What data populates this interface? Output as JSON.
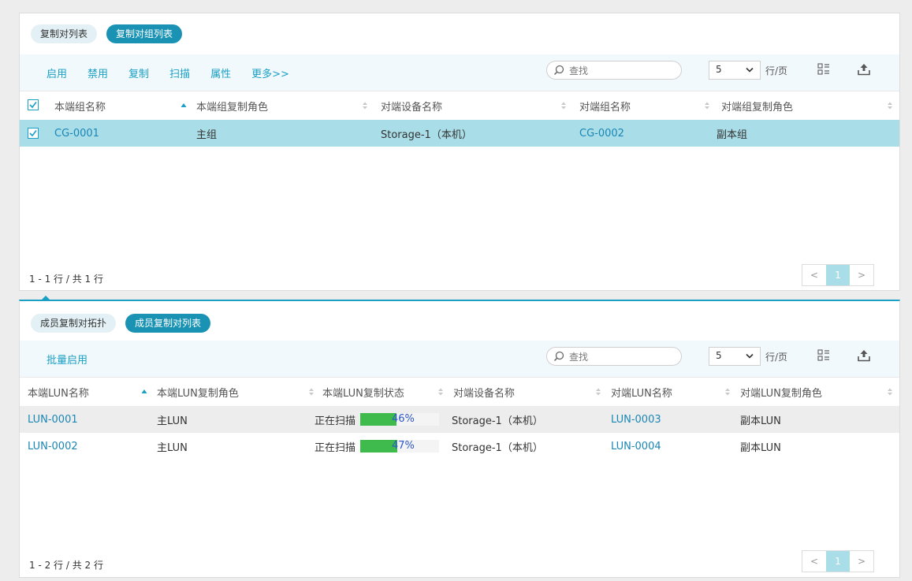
{
  "top": {
    "tabs": [
      {
        "label": "复制对列表",
        "active": false
      },
      {
        "label": "复制对组列表",
        "active": true
      }
    ],
    "actions": [
      "启用",
      "禁用",
      "复制",
      "扫描",
      "属性",
      "更多>>"
    ],
    "search": {
      "placeholder": "查找",
      "value": ""
    },
    "page_size": "5",
    "per_page_label": "行/页",
    "columns": [
      "本端组名称",
      "本端组复制角色",
      "对端设备名称",
      "对端组名称",
      "对端组复制角色"
    ],
    "rows": [
      {
        "checked": true,
        "local_group": "CG-0001",
        "local_role": "主组",
        "peer_device": "Storage-1（本机）",
        "peer_group": "CG-0002",
        "peer_role": "副本组"
      }
    ],
    "header_checked": true,
    "footer": "1 - 1 行 / 共 1 行",
    "pager": {
      "prev": "<",
      "current": "1",
      "next": ">"
    }
  },
  "bottom": {
    "tabs": [
      {
        "label": "成员复制对拓扑",
        "active": false
      },
      {
        "label": "成员复制对列表",
        "active": true
      }
    ],
    "actions": [
      "批量启用"
    ],
    "search": {
      "placeholder": "查找",
      "value": ""
    },
    "page_size": "5",
    "per_page_label": "行/页",
    "columns": [
      "本端LUN名称",
      "本端LUN复制角色",
      "本端LUN复制状态",
      "对端设备名称",
      "对端LUN名称",
      "对端LUN复制角色"
    ],
    "rows": [
      {
        "local_lun": "LUN-0001",
        "local_role": "主LUN",
        "status_text": "正在扫描",
        "progress": 46,
        "progress_label": "46%",
        "peer_device": "Storage-1（本机）",
        "peer_lun": "LUN-0003",
        "peer_role": "副本LUN"
      },
      {
        "local_lun": "LUN-0002",
        "local_role": "主LUN",
        "status_text": "正在扫描",
        "progress": 47,
        "progress_label": "47%",
        "peer_device": "Storage-1（本机）",
        "peer_lun": "LUN-0004",
        "peer_role": "副本LUN"
      }
    ],
    "footer": "1 - 2 行 / 共 2 行",
    "pager": {
      "prev": "<",
      "current": "1",
      "next": ">"
    }
  },
  "colors": {
    "accent": "#1aa0c4",
    "tab_active": "#1992b3",
    "selected_row": "#a9dde7",
    "link": "#1a86b4",
    "progress_fill": "#3fbb4e"
  },
  "icons": {
    "search": "search-icon",
    "dropdown": "chevron-down-icon",
    "columns": "column-settings-icon",
    "export": "export-icon",
    "sort": "sort-icon",
    "checkbox": "checkmark-icon"
  }
}
